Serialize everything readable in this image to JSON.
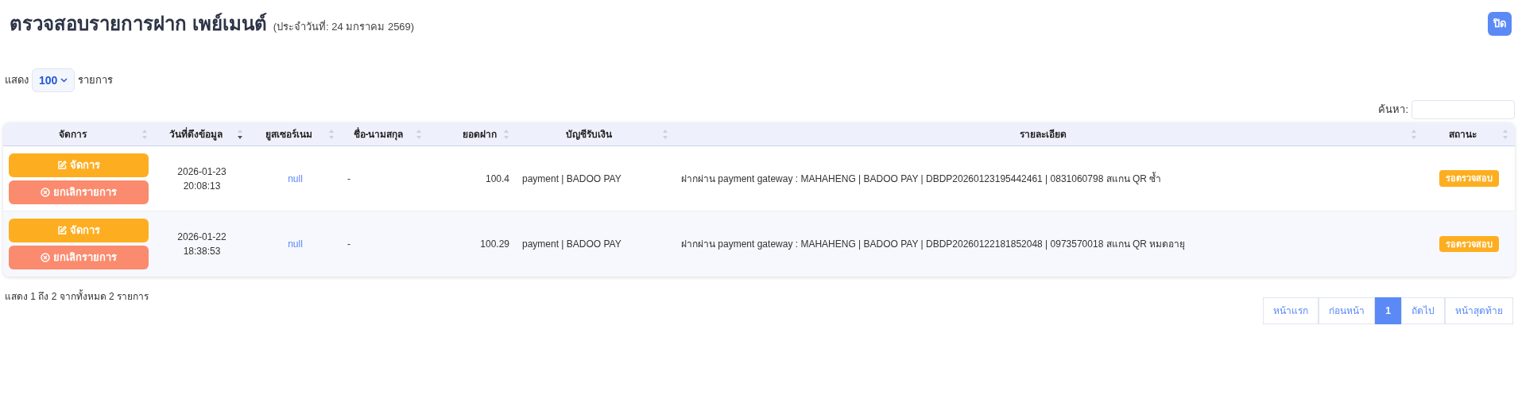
{
  "header": {
    "title": "ตรวจสอบรายการฝาก เพย์เมนต์",
    "subtitle": "(ประจำวันที่: 24 มกราคม 2569)",
    "close_button": "ปิด"
  },
  "length_menu": {
    "prefix": "แสดง",
    "value": "100",
    "suffix": "รายการ"
  },
  "search": {
    "label": "ค้นหา:"
  },
  "table": {
    "columns": [
      {
        "label": "จัดการ",
        "sorted": false
      },
      {
        "label": "วันที่ดึงข้อมูล",
        "sorted": true
      },
      {
        "label": "ยูสเซอร์เนม",
        "sorted": false
      },
      {
        "label": "ชื่อ-นามสกุล",
        "sorted": false
      },
      {
        "label": "ยอดฝาก",
        "sorted": false
      },
      {
        "label": "บัญชีรับเงิน",
        "sorted": false
      },
      {
        "label": "รายละเอียด",
        "sorted": false
      },
      {
        "label": "สถานะ",
        "sorted": false
      }
    ],
    "rows": [
      {
        "actions": [
          "จัดการ",
          "ยกเลิกรายการ"
        ],
        "date": "2026-01-23",
        "time": "20:08:13",
        "username": "null",
        "name": "-",
        "amount": "100.4",
        "account": "payment | BADOO PAY",
        "detail": "ฝากผ่าน payment gateway : MAHAHENG | BADOO PAY | DBDP20260123195442461 | 0831060798 สแกน QR ซ้ำ",
        "status": "รอตรวจสอบ"
      },
      {
        "actions": [
          "จัดการ",
          "ยกเลิกรายการ"
        ],
        "date": "2026-01-22",
        "time": "18:38:53",
        "username": "null",
        "name": "-",
        "amount": "100.29",
        "account": "payment | BADOO PAY",
        "detail": "ฝากผ่าน payment gateway : MAHAHENG | BADOO PAY | DBDP20260122181852048 | 0973570018 สแกน QR หมดอายุ",
        "status": "รอตรวจสอบ"
      }
    ]
  },
  "info": "แสดง 1 ถึง 2 จากทั้งหมด 2 รายการ",
  "pagination": [
    {
      "label": "หน้าแรก",
      "selected": false
    },
    {
      "label": "ก่อนหน้า",
      "selected": false
    },
    {
      "label": "1",
      "selected": true
    },
    {
      "label": "ถัดไป",
      "selected": false
    },
    {
      "label": "หน้าสุดท้าย",
      "selected": false
    }
  ]
}
